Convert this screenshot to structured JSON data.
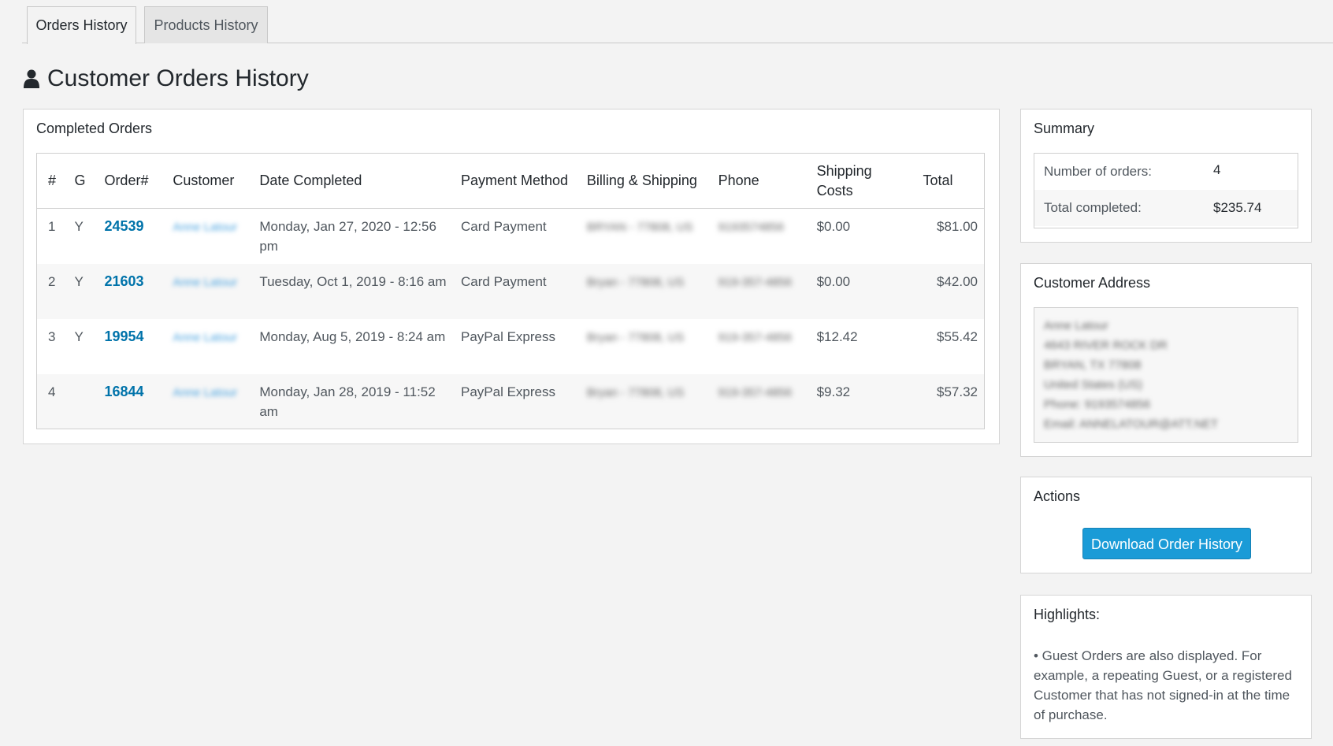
{
  "tabs": [
    {
      "label": "Orders History",
      "active": true
    },
    {
      "label": "Products History",
      "active": false
    }
  ],
  "page_title": "Customer Orders History",
  "orders_panel": {
    "title": "Completed Orders",
    "columns": [
      "#",
      "G",
      "Order#",
      "Customer",
      "Date Completed",
      "Payment Method",
      "Billing & Shipping",
      "Phone",
      "Shipping Costs",
      "Total"
    ],
    "rows": [
      {
        "num": "1",
        "g": "Y",
        "order": "24539",
        "customer": "Anne Latour",
        "date": "Monday, Jan 27, 2020 - 12:56 pm",
        "payment": "Card Payment",
        "billing": "BRYAN - 77808, US",
        "phone": "9193574856",
        "shipping": "$0.00",
        "total": "$81.00"
      },
      {
        "num": "2",
        "g": "Y",
        "order": "21603",
        "customer": "Anne Latour",
        "date": "Tuesday, Oct 1, 2019 - 8:16 am",
        "payment": "Card Payment",
        "billing": "Bryan - 77808, US",
        "phone": "919-357-4856",
        "shipping": "$0.00",
        "total": "$42.00"
      },
      {
        "num": "3",
        "g": "Y",
        "order": "19954",
        "customer": "Anne Latour",
        "date": "Monday, Aug 5, 2019 - 8:24 am",
        "payment": "PayPal Express",
        "billing": "Bryan - 77808, US",
        "phone": "919-357-4856",
        "shipping": "$12.42",
        "total": "$55.42"
      },
      {
        "num": "4",
        "g": "",
        "order": "16844",
        "customer": "Anne Latour",
        "date": "Monday, Jan 28, 2019 - 11:52 am",
        "payment": "PayPal Express",
        "billing": "Bryan - 77808, US",
        "phone": "919-357-4856",
        "shipping": "$9.32",
        "total": "$57.32"
      }
    ]
  },
  "summary": {
    "title": "Summary",
    "number_label": "Number of orders:",
    "number_value": "4",
    "total_label": "Total completed:",
    "total_value": "$235.74"
  },
  "address": {
    "title": "Customer Address",
    "lines": [
      "Anne Latour",
      "4643 RIVER ROCK DR",
      "BRYAN, TX 77808",
      "United States (US)",
      "Phone: 9193574856",
      "Email: ANNELATOUR@ATT.NET"
    ]
  },
  "actions": {
    "title": "Actions",
    "download_label": "Download Order History"
  },
  "highlights": {
    "title": "Highlights:",
    "text": "• Guest Orders are also displayed. For example, a repeating Guest, or a registered Customer that has not signed-in at the time of purchase."
  },
  "colors": {
    "link": "#0073aa",
    "button": "#1a9bd7",
    "background": "#f3f3f3"
  }
}
